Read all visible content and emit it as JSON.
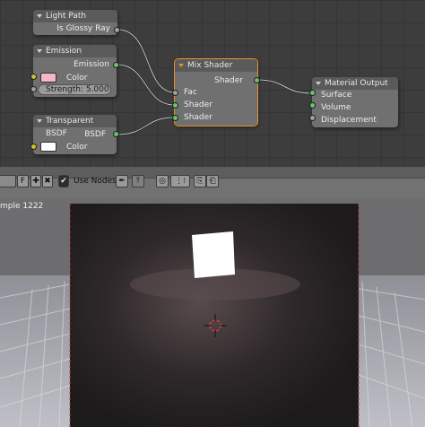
{
  "nodes": {
    "light_path": {
      "title": "Light Path",
      "output": "Is Glossy Ray"
    },
    "emission": {
      "title": "Emission",
      "output": "Emission",
      "color_label": "Color",
      "color_value": "#f4b8c4",
      "strength": "Strength: 5.000"
    },
    "transparent": {
      "title": "Transparent BSDF",
      "output": "BSDF",
      "color_label": "Color",
      "color_value": "#ffffff"
    },
    "mix": {
      "title": "Mix Shader",
      "output": "Shader",
      "inputs": [
        "Fac",
        "Shader",
        "Shader"
      ]
    },
    "output": {
      "title": "Material Output",
      "inputs": [
        "Surface",
        "Volume",
        "Displacement"
      ]
    }
  },
  "toolbar": {
    "f_label": "F",
    "use_nodes": "Use Nodes"
  },
  "viewport": {
    "sample_text": "mple 1222"
  },
  "colors": {
    "socket_shader": "#63c763",
    "socket_color": "#c7c729",
    "socket_value": "#a1a1a1",
    "selected_node": "#e8902a"
  }
}
